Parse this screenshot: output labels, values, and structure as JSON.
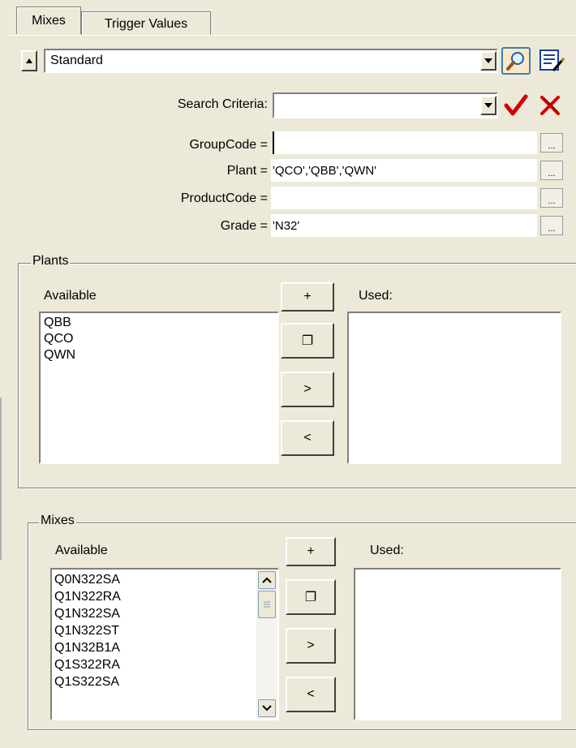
{
  "tabs": [
    {
      "label": "Mixes"
    },
    {
      "label": "Trigger Values"
    }
  ],
  "view_select": {
    "value": "Standard"
  },
  "search_criteria": {
    "label": "Search Criteria:",
    "value": ""
  },
  "criteria": [
    {
      "label": "GroupCode =",
      "value": ""
    },
    {
      "label": "Plant =",
      "value": "'QCO','QBB','QWN'"
    },
    {
      "label": "ProductCode =",
      "value": ""
    },
    {
      "label": "Grade =",
      "value": "'N32'"
    }
  ],
  "dots_label": "...",
  "plants": {
    "title": "Plants",
    "available_label": "Available",
    "used_label": "Used:",
    "available": [
      "QBB",
      "QCO",
      "QWN"
    ],
    "used": [],
    "buttons": {
      "add": "+",
      "copy": "❐",
      "move_right": ">",
      "move_left": "<"
    }
  },
  "mixes": {
    "title": "Mixes",
    "available_label": "Available",
    "used_label": "Used:",
    "available": [
      "Q0N322SA",
      "Q1N322RA",
      "Q1N322SA",
      "Q1N322ST",
      "Q1N32B1A",
      "Q1S322RA",
      "Q1S322SA"
    ],
    "used": [],
    "buttons": {
      "add": "+",
      "copy": "❐",
      "move_right": ">",
      "move_left": "<"
    }
  },
  "icons": {
    "search": "magnifier-icon",
    "edit": "notepad-edit-icon",
    "accept": "checkmark-icon",
    "clear": "x-icon"
  },
  "colors": {
    "background": "#ece9d8",
    "accept": "#d40000",
    "clear": "#d40000"
  }
}
